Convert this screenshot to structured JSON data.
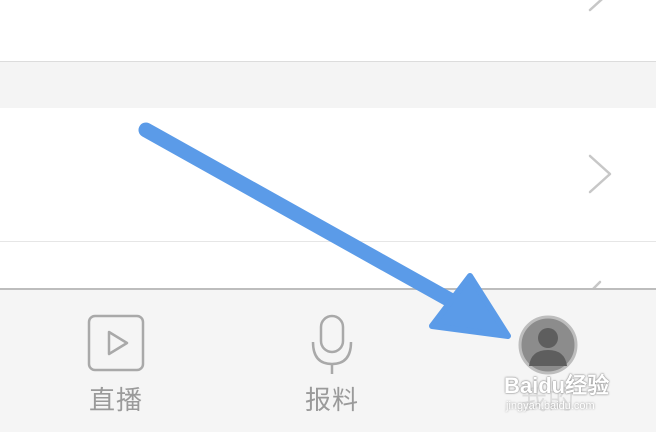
{
  "tabbar": {
    "tabs": [
      {
        "id": "live",
        "label": "直播",
        "icon": "play-square-icon"
      },
      {
        "id": "report",
        "label": "报料",
        "icon": "microphone-icon"
      },
      {
        "id": "me",
        "label": "我的",
        "icon": "user-avatar-icon"
      }
    ]
  },
  "watermark": {
    "title": "Baidu经验",
    "url": "jingyan.baidu.com"
  },
  "overlay": {
    "arrow_icon": "pointer-arrow-icon",
    "arrow_color": "#5b9be8"
  },
  "colors": {
    "background": "#ffffff",
    "separator_band": "#f4f4f4",
    "tabbar_background": "#f5f5f5",
    "tab_inactive": "#9a9a9a",
    "chevron": "#c7c7c7"
  }
}
